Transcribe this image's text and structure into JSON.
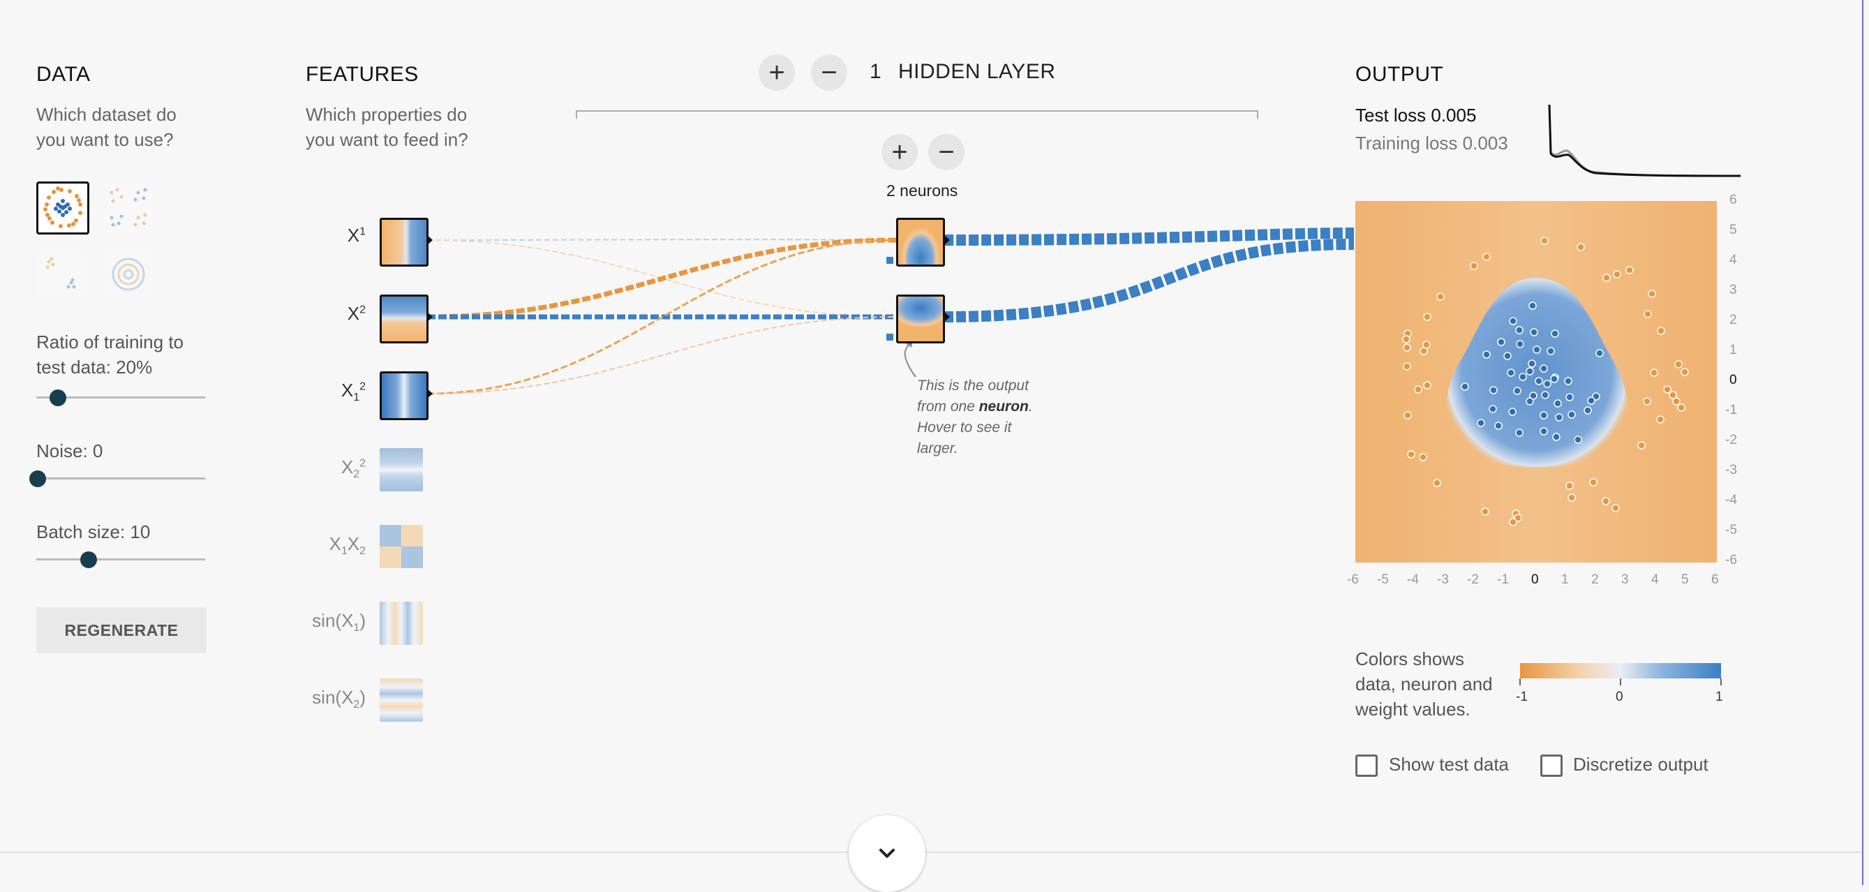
{
  "data_panel": {
    "title": "DATA",
    "question_line1": "Which dataset do",
    "question_line2": "you want to use?",
    "datasets": [
      {
        "icon": "circle-dataset-icon",
        "selected": true
      },
      {
        "icon": "xor-dataset-icon",
        "selected": false
      },
      {
        "icon": "gaussian-dataset-icon",
        "selected": false
      },
      {
        "icon": "spiral-dataset-icon",
        "selected": false
      }
    ],
    "ratio_label_line1": "Ratio of training to",
    "ratio_label_line2": "test data:  20%",
    "ratio_value": 0.2,
    "noise_label": "Noise:  0",
    "noise_value": 0,
    "batch_label": "Batch size:  10",
    "batch_value": 0.3,
    "regenerate_label": "REGENERATE"
  },
  "features_panel": {
    "title": "FEATURES",
    "question_line1": "Which properties do",
    "question_line2": "you want to feed in?",
    "features": [
      {
        "label": "X",
        "sup": "1",
        "post": "",
        "active": true
      },
      {
        "label": "X",
        "sup": "2",
        "post": "",
        "active": true
      },
      {
        "label": "X",
        "sub": "1",
        "sup": "2",
        "active": true
      },
      {
        "label": "X",
        "sub": "2",
        "sup": "2",
        "active": false
      },
      {
        "label": "X",
        "sub": "1",
        "mid": "X",
        "sub2": "2",
        "active": false
      },
      {
        "label": "sin(X",
        "sub": "1",
        "post": ")",
        "active": false
      },
      {
        "label": "sin(X",
        "sub": "2",
        "post": ")",
        "active": false
      }
    ]
  },
  "hidden": {
    "add_layer": "+",
    "remove_layer": "−",
    "count": "1",
    "title": "HIDDEN LAYER",
    "add_neuron": "+",
    "remove_neuron": "−",
    "neurons_label": "2 neurons",
    "hint_line1": "This is the output",
    "hint_line2a": "from one ",
    "hint_line2b": "neuron",
    "hint_line2c": ".",
    "hint_line3": "Hover to see it",
    "hint_line4": "larger."
  },
  "output": {
    "title": "OUTPUT",
    "test_loss": "Test loss 0.005",
    "training_loss": "Training loss 0.003",
    "y_ticks": [
      "6",
      "5",
      "4",
      "3",
      "2",
      "1",
      "0",
      "-1",
      "-2",
      "-3",
      "-4",
      "-5",
      "-6"
    ],
    "x_ticks": [
      "-6",
      "-5",
      "-4",
      "-3",
      "-2",
      "-1",
      "0",
      "1",
      "2",
      "3",
      "4",
      "5",
      "6"
    ],
    "legend_line1": "Colors shows",
    "legend_line2": "data, neuron and",
    "legend_line3": "weight values.",
    "legend_min": "-1",
    "legend_mid": "0",
    "legend_max": "1",
    "show_test_label": "Show test data",
    "discretize_label": "Discretize output"
  },
  "colors": {
    "orange": "#f0a44a",
    "blue": "#3b7fc4",
    "dark": "#183d4e"
  },
  "footer": {
    "expand_icon": "chevron-down-icon"
  }
}
